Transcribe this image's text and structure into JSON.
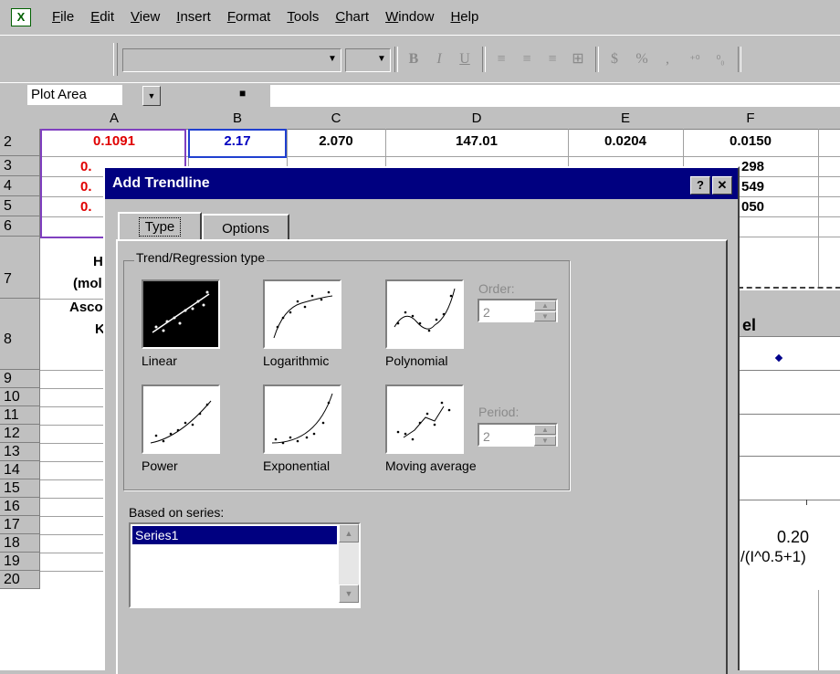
{
  "menubar": {
    "items": [
      "File",
      "Edit",
      "View",
      "Insert",
      "Format",
      "Tools",
      "Chart",
      "Window",
      "Help"
    ]
  },
  "toolbar": {
    "buttons": [
      "B",
      "I",
      "U",
      "%",
      ","
    ]
  },
  "formula_bar": {
    "name_box": "Plot Area",
    "formula": ""
  },
  "sheet": {
    "columns": [
      "A",
      "B",
      "C",
      "D",
      "E",
      "F"
    ],
    "rows": [
      "2",
      "3",
      "4",
      "5",
      "6",
      "7",
      "8",
      "9",
      "10",
      "11",
      "12",
      "13",
      "14",
      "15",
      "16",
      "17",
      "18",
      "19",
      "20"
    ],
    "row2": {
      "A": "0.1091",
      "B": "2.17",
      "C": "2.070",
      "D": "147.01",
      "E": "0.0204",
      "F": "0.0150"
    },
    "row3": {
      "A": "0.",
      "F": "298"
    },
    "row4": {
      "A": "0.",
      "F": "549"
    },
    "row5": {
      "A": "0.",
      "F": "050"
    },
    "row7": {
      "A1": "H",
      "A2": "(mol"
    },
    "row8": {
      "A1": "Ascor",
      "A2": "K"
    },
    "chart_fragment_title": "el",
    "chart_fragment_tick": "0.20",
    "chart_fragment_axis": "/(I^0.5+1)"
  },
  "dialog": {
    "title": "Add Trendline",
    "help_btn": "?",
    "close_btn": "✕",
    "tabs": [
      "Type",
      "Options"
    ],
    "group_label": "Trend/Regression type",
    "types": [
      "Linear",
      "Logarithmic",
      "Polynomial",
      "Power",
      "Exponential",
      "Moving average"
    ],
    "order_label": "Order:",
    "order_value": "2",
    "period_label": "Period:",
    "period_value": "2",
    "series_label": "Based on series:",
    "series_items": [
      "Series1"
    ],
    "selected_type": "Linear"
  }
}
